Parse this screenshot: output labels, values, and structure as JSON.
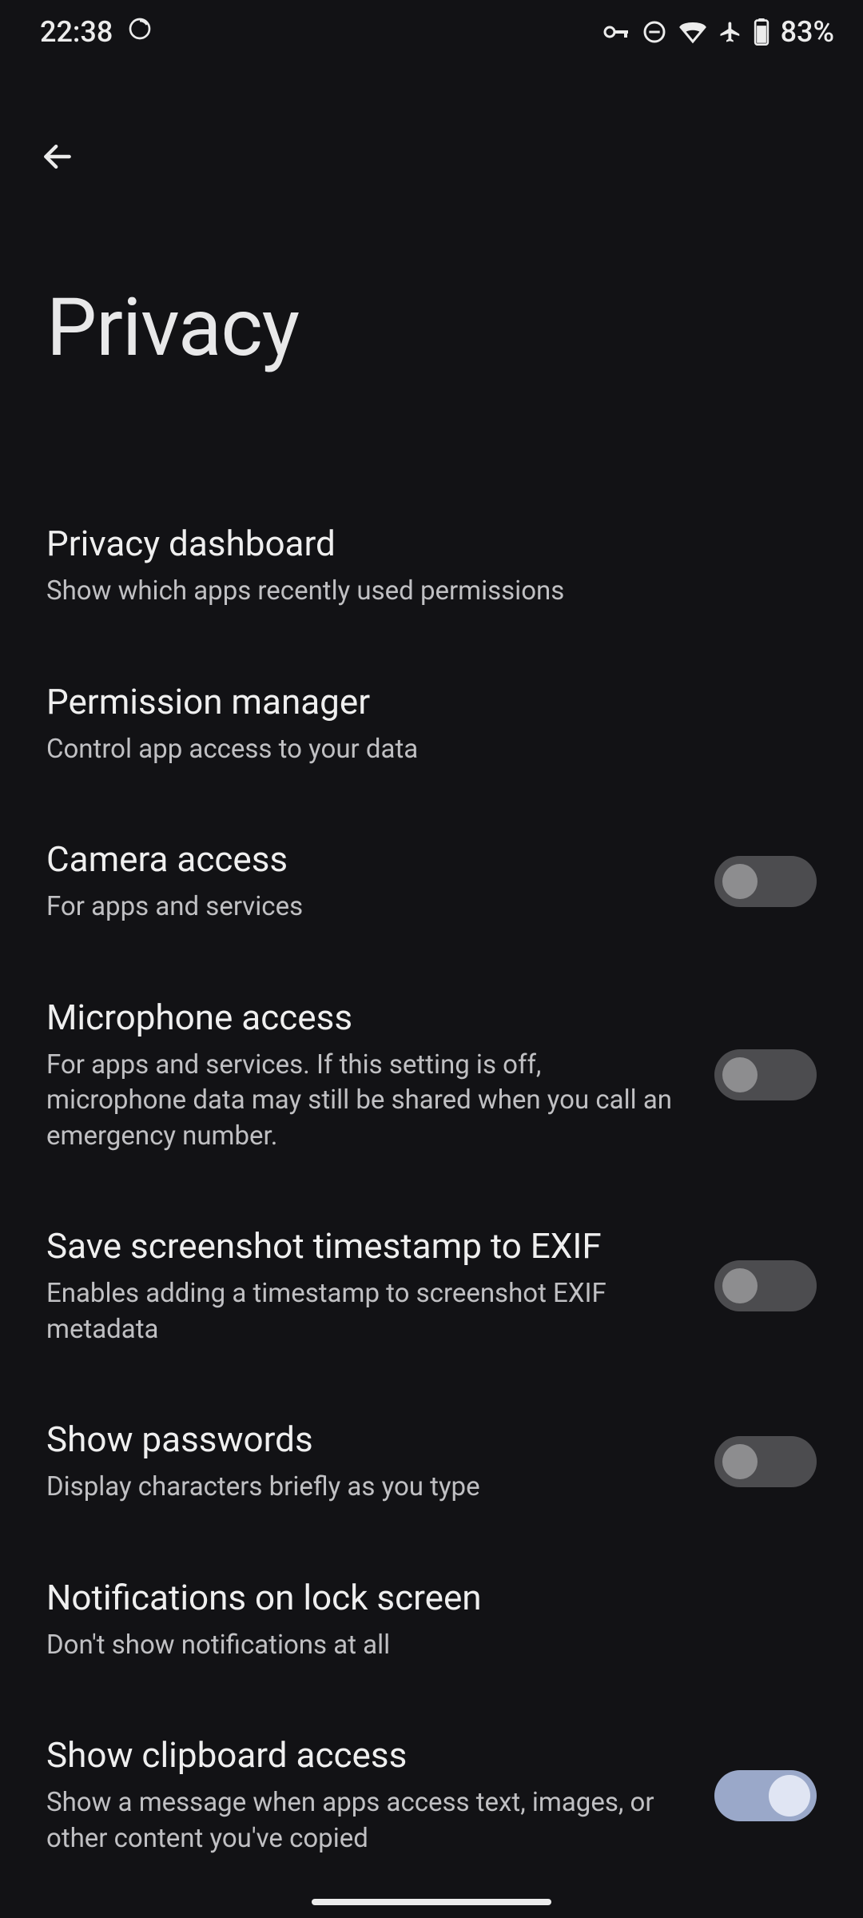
{
  "status": {
    "time": "22:38",
    "battery": "83%"
  },
  "header": {
    "title": "Privacy"
  },
  "items": [
    {
      "title": "Privacy dashboard",
      "sub": "Show which apps recently used permissions",
      "toggle": null
    },
    {
      "title": "Permission manager",
      "sub": "Control app access to your data",
      "toggle": null
    },
    {
      "title": "Camera access",
      "sub": "For apps and services",
      "toggle": false
    },
    {
      "title": "Microphone access",
      "sub": "For apps and services. If this setting is off, microphone data may still be shared when you call an emergency number.",
      "toggle": false
    },
    {
      "title": "Save screenshot timestamp to EXIF",
      "sub": "Enables adding a timestamp to screenshot EXIF metadata",
      "toggle": false
    },
    {
      "title": "Show passwords",
      "sub": "Display characters briefly as you type",
      "toggle": false
    },
    {
      "title": "Notifications on lock screen",
      "sub": "Don't show notifications at all",
      "toggle": null
    },
    {
      "title": "Show clipboard access",
      "sub": "Show a message when apps access text, images, or other content you've copied",
      "toggle": true
    }
  ]
}
